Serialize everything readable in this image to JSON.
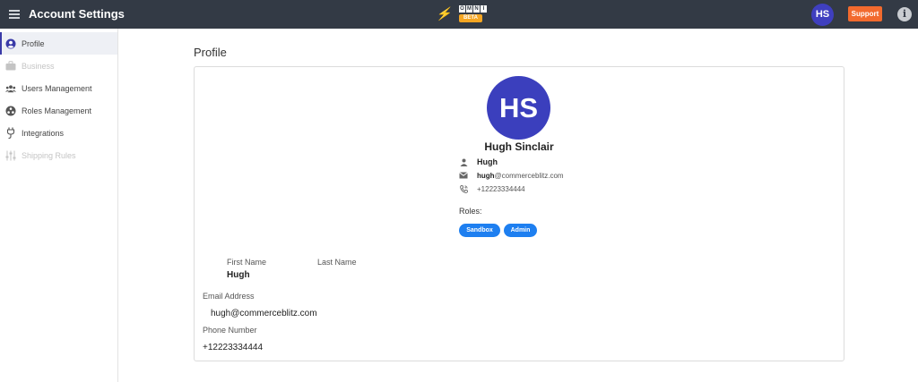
{
  "header": {
    "title": "Account Settings",
    "logo_text": "OMNI",
    "logo_letters": [
      "O",
      "M",
      "N",
      "I"
    ],
    "logo_badge": "BETA",
    "avatar_initials": "HS",
    "support_label": "Support",
    "info_icon": "i"
  },
  "sidebar": {
    "items": [
      {
        "label": "Profile",
        "icon": "user-circle-icon",
        "state": "active"
      },
      {
        "label": "Business",
        "icon": "briefcase-icon",
        "state": "disabled"
      },
      {
        "label": "Users Management",
        "icon": "users-icon",
        "state": "normal"
      },
      {
        "label": "Roles Management",
        "icon": "roles-icon",
        "state": "normal"
      },
      {
        "label": "Integrations",
        "icon": "plug-icon",
        "state": "normal"
      },
      {
        "label": "Shipping Rules",
        "icon": "sliders-icon",
        "state": "disabled"
      }
    ]
  },
  "profile": {
    "page_title": "Profile",
    "avatar_initials": "HS",
    "full_name": "Hugh Sinclair",
    "username": "Hugh",
    "email_user": "hugh",
    "email_domain": "@commerceblitz.com",
    "phone": "+12223334444",
    "roles_label": "Roles:",
    "roles": [
      "Sandbox",
      "Admin"
    ],
    "fields": {
      "first_name_label": "First Name",
      "first_name_value": "Hugh",
      "last_name_label": "Last Name",
      "last_name_value": "",
      "email_label": "Email Address",
      "email_value": "hugh@commerceblitz.com",
      "phone_label": "Phone Number",
      "phone_value": "+12223334444"
    }
  },
  "colors": {
    "topbar": "#333a45",
    "avatar": "#3b3fbd",
    "support": "#f26a2e",
    "role_chip": "#1e7ff0"
  }
}
